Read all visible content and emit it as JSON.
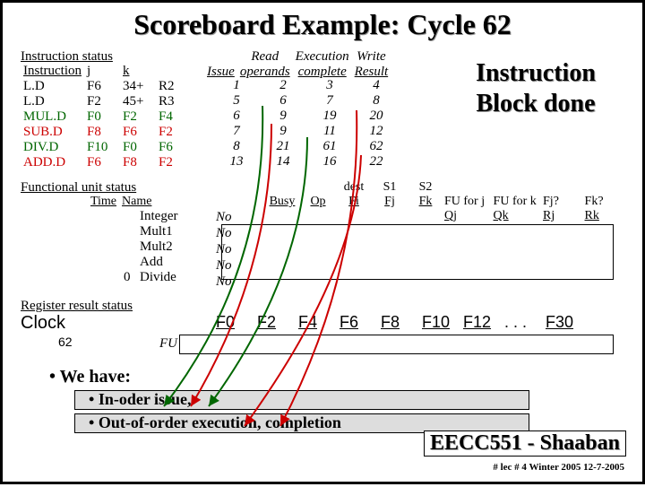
{
  "title": "Scoreboard Example:  Cycle 62",
  "labels": {
    "instr_status": "Instruction status",
    "func_unit": "Functional unit status",
    "reg_result": "Register result status",
    "clock": "Clock",
    "cycle": "62",
    "fu": "FU",
    "bigtext_l1": "Instruction",
    "bigtext_l2": "Block done"
  },
  "instr_hdr": {
    "instruction": "Instruction",
    "j": "j",
    "k": "k"
  },
  "issue_hdr": {
    "issue": "Issue",
    "read": "Read",
    "operands": "operands",
    "exec": "Execution",
    "complete": "complete",
    "write": "Write",
    "result": "Result"
  },
  "instructions": [
    {
      "op": "L.D",
      "i": "F6",
      "j": "34+",
      "k": "R2",
      "color": ""
    },
    {
      "op": "L.D",
      "i": "F2",
      "j": "45+",
      "k": "R3",
      "color": ""
    },
    {
      "op": "MUL.D",
      "i": "F0",
      "j": "F2",
      "k": "F4",
      "color": "green"
    },
    {
      "op": "SUB.D",
      "i": "F8",
      "j": "F6",
      "k": "F2",
      "color": "red"
    },
    {
      "op": "DIV.D",
      "i": "F10",
      "j": "F0",
      "k": "F6",
      "color": "green"
    },
    {
      "op": "ADD.D",
      "i": "F6",
      "j": "F8",
      "k": "F2",
      "color": "red"
    }
  ],
  "cycles": [
    {
      "issue": "1",
      "read": "2",
      "exec": "3",
      "write": "4"
    },
    {
      "issue": "5",
      "read": "6",
      "exec": "7",
      "write": "8"
    },
    {
      "issue": "6",
      "read": "9",
      "exec": "19",
      "write": "20"
    },
    {
      "issue": "7",
      "read": "9",
      "exec": "11",
      "write": "12"
    },
    {
      "issue": "8",
      "read": "21",
      "exec": "61",
      "write": "62"
    },
    {
      "issue": "13",
      "read": "14",
      "exec": "16",
      "write": "22"
    }
  ],
  "fu_hdr": {
    "time": "Time",
    "name": "Name",
    "busy": "Busy",
    "op": "Op",
    "fi": "Fi",
    "fj": "Fj",
    "fk": "Fk"
  },
  "fu_dest": {
    "dest": "dest",
    "s1": "S1",
    "s2": "S2"
  },
  "fu_far": {
    "fuj": "FU for j",
    "fuk": "FU for k",
    "fjq": "Fj?",
    "fkq": "Fk?",
    "qj": "Qj",
    "qk": "Qk",
    "rj": "Rj",
    "rk": "Rk"
  },
  "func_units": [
    {
      "time": "",
      "name": "Integer",
      "busy": "No"
    },
    {
      "time": "",
      "name": "Mult1",
      "busy": "No"
    },
    {
      "time": "",
      "name": "Mult2",
      "busy": "No"
    },
    {
      "time": "",
      "name": "Add",
      "busy": "No"
    },
    {
      "time": "0",
      "name": "Divide",
      "busy": "No"
    }
  ],
  "regs": [
    "F0",
    "F2",
    "F4",
    "F6",
    "F8",
    "F10",
    "F12",
    ". . .",
    "F30"
  ],
  "bullets": {
    "main": "We have:",
    "s1": "In-oder issue,",
    "s2": "Out-of-order execution, completion"
  },
  "footer": {
    "course": "EECC551 - Shaaban",
    "info": "#  lec # 4  Winter 2005    12-7-2005"
  }
}
